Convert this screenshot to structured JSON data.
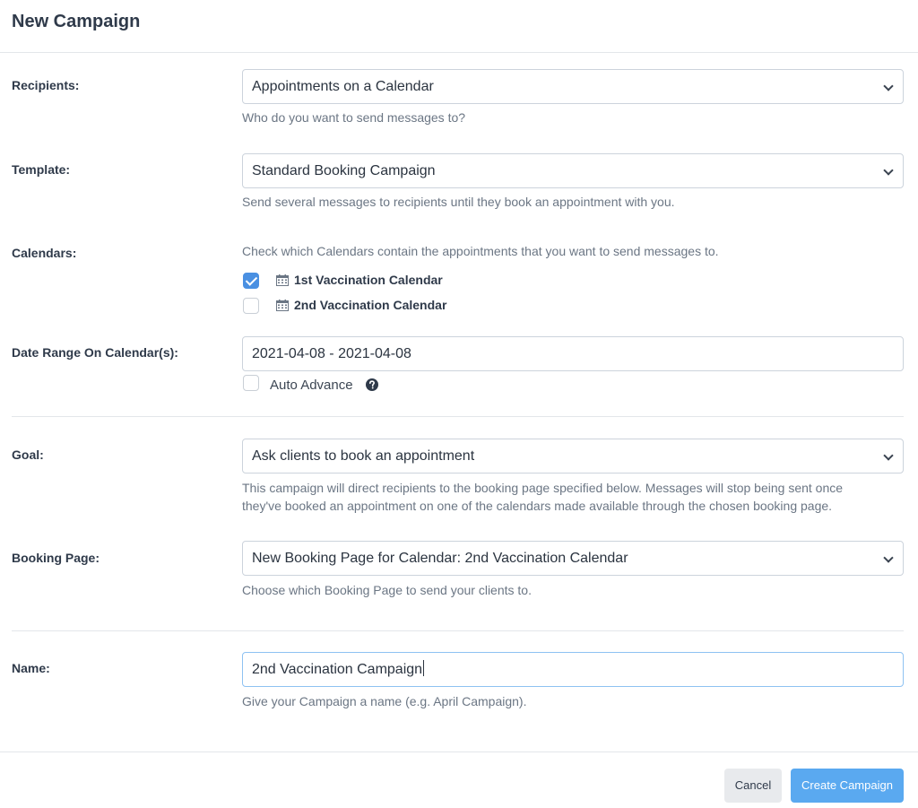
{
  "modal": {
    "title": "New Campaign"
  },
  "recipients": {
    "label": "Recipients:",
    "value": "Appointments on a Calendar",
    "help": "Who do you want to send messages to?"
  },
  "template": {
    "label": "Template:",
    "value": "Standard Booking Campaign",
    "help": "Send several messages to recipients until they book an appointment with you."
  },
  "calendars": {
    "label": "Calendars:",
    "help": "Check which Calendars contain the appointments that you want to send messages to.",
    "items": [
      {
        "label": "1st Vaccination Calendar",
        "checked": true
      },
      {
        "label": "2nd Vaccination Calendar",
        "checked": false
      }
    ]
  },
  "date_range": {
    "label": "Date Range On Calendar(s):",
    "value": "2021-04-08 - 2021-04-08",
    "auto_advance_label": "Auto Advance",
    "auto_advance_checked": false
  },
  "goal": {
    "label": "Goal:",
    "value": "Ask clients to book an appointment",
    "help_line1": "This campaign will direct recipients to the booking page specified below. Messages will stop being sent once",
    "help_line2": "they've booked an appointment on one of the calendars made available through the chosen booking page."
  },
  "booking_page": {
    "label": "Booking Page:",
    "value": "New Booking Page for Calendar: 2nd Vaccination Calendar",
    "help": "Choose which Booking Page to send your clients to."
  },
  "name": {
    "label": "Name:",
    "value": "2nd Vaccination Campaign",
    "help": "Give your Campaign a name (e.g. April Campaign)."
  },
  "footer": {
    "cancel_label": "Cancel",
    "create_label": "Create Campaign"
  },
  "colors": {
    "primary": "#5aa9f0",
    "checkbox_checked": "#4a90e2",
    "focus_border": "#8ec2f2"
  }
}
